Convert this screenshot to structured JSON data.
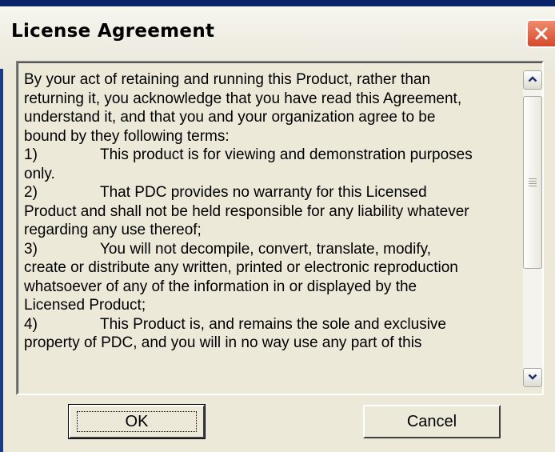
{
  "window": {
    "title": "License Agreement",
    "close_icon": "close-x-icon",
    "accent_color": "#d54a2c"
  },
  "license": {
    "lines": [
      {
        "num": "",
        "text": "By your act of retaining and running this Product, rather than"
      },
      {
        "num": "",
        "text": "returning it, you acknowledge that you have read this Agreement,"
      },
      {
        "num": "",
        "text": "understand it, and that you and your organization agree to be"
      },
      {
        "num": "",
        "text": "bound by they following terms:"
      },
      {
        "num": "1)",
        "text": "This product is for viewing and demonstration purposes"
      },
      {
        "num": "",
        "text": "only."
      },
      {
        "num": "2)",
        "text": "That PDC provides no warranty for this Licensed"
      },
      {
        "num": "",
        "text": "Product and shall not be held responsible for any liability whatever"
      },
      {
        "num": "",
        "text": "regarding any use thereof;"
      },
      {
        "num": "3)",
        "text": "You will not decompile, convert, translate, modify,"
      },
      {
        "num": "",
        "text": "create or distribute any written, printed or electronic reproduction"
      },
      {
        "num": "",
        "text": "whatsoever of any of the information in or displayed by the"
      },
      {
        "num": "",
        "text": "Licensed Product;"
      },
      {
        "num": "4)",
        "text": "This Product is, and remains the sole and exclusive"
      },
      {
        "num": "",
        "text": "property of PDC, and you will in no way use any part of this"
      }
    ]
  },
  "scrollbar": {
    "up_icon": "chevron-up-icon",
    "down_icon": "chevron-down-icon",
    "position_fraction": 0.0
  },
  "buttons": {
    "ok_label": "OK",
    "cancel_label": "Cancel"
  }
}
